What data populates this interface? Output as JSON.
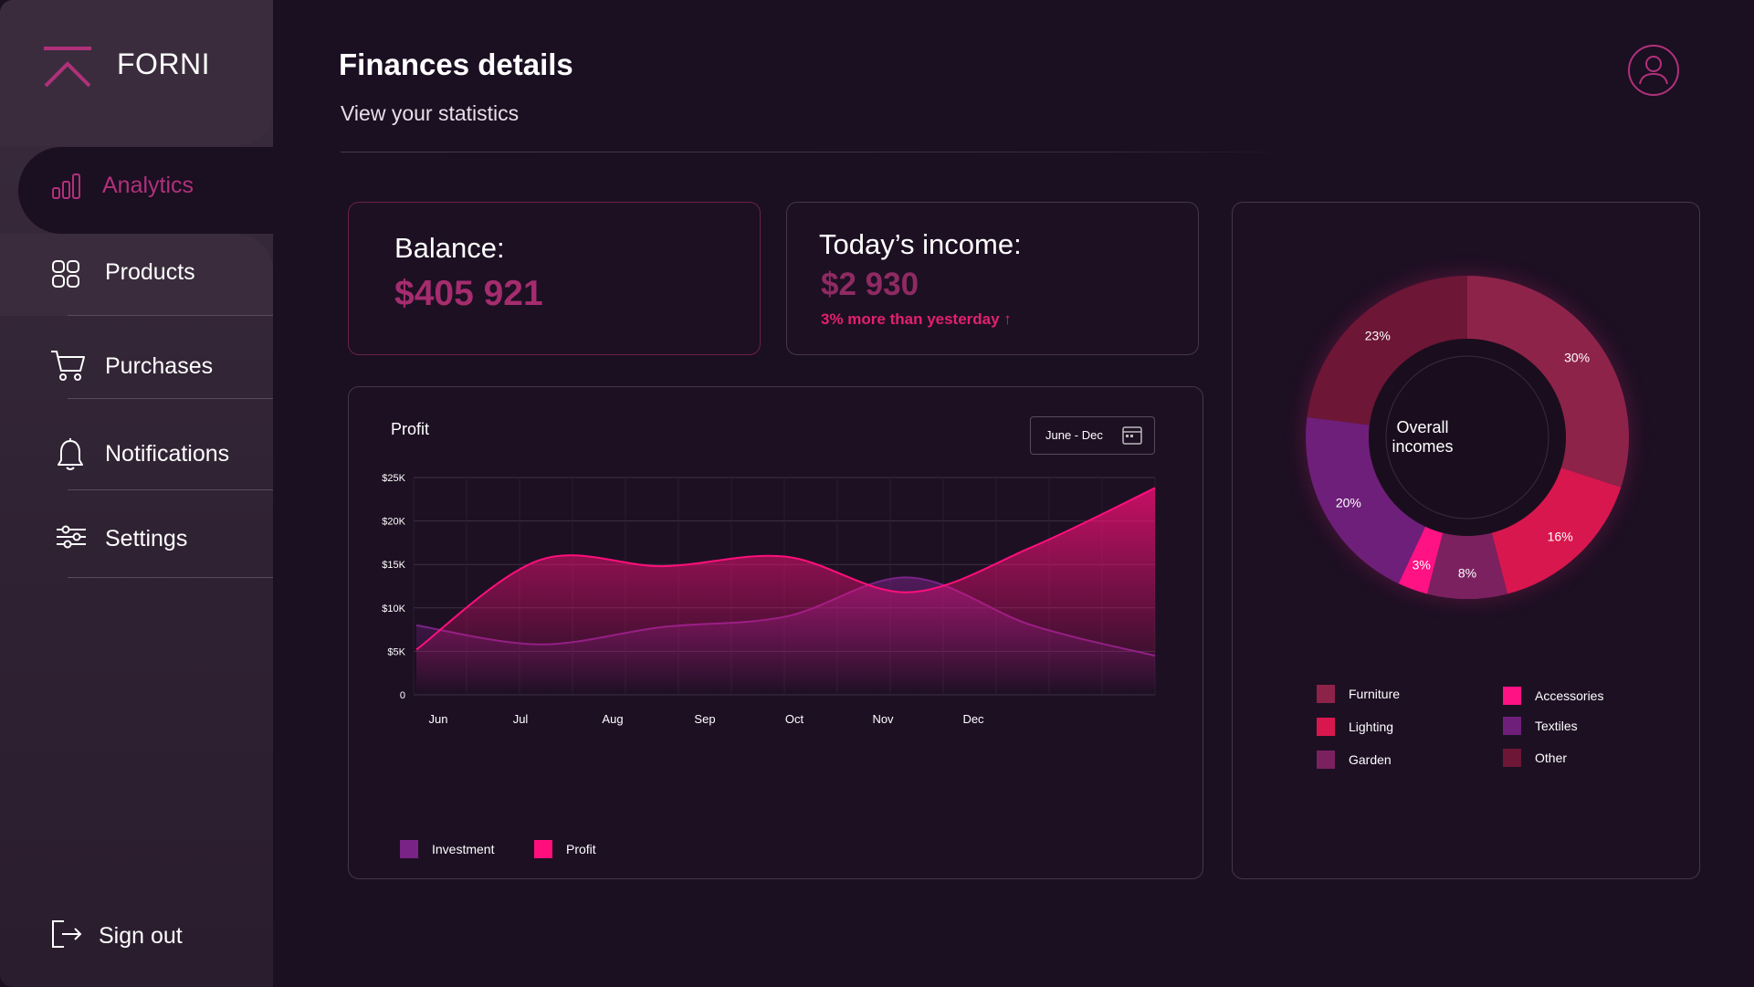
{
  "brand": {
    "name": "FORNI",
    "accent": "#b0317a"
  },
  "sidebar": {
    "items": [
      {
        "label": "Analytics",
        "icon": "bar-chart-icon",
        "active": true
      },
      {
        "label": "Products",
        "icon": "grid-icon"
      },
      {
        "label": "Purchases",
        "icon": "cart-icon"
      },
      {
        "label": "Notifications",
        "icon": "bell-icon"
      },
      {
        "label": "Settings",
        "icon": "sliders-icon"
      }
    ],
    "signout": {
      "label": "Sign out",
      "icon": "sign-out-icon"
    }
  },
  "header": {
    "title": "Finances details",
    "subtitle": "View your statistics",
    "avatar_icon": "user-icon"
  },
  "balance": {
    "label": "Balance:",
    "value": "$405 921"
  },
  "income": {
    "label": "Today’s income:",
    "value": "$2 930",
    "note": "3% more than yesterday ↑"
  },
  "profit_panel": {
    "title": "Profit",
    "date_range": "June - Dec",
    "date_icon": "calendar-icon"
  },
  "chart_data": [
    {
      "type": "area",
      "title": "Profit",
      "x": [
        "Jun",
        "Jul",
        "Aug",
        "Sep",
        "Oct",
        "Nov",
        "Dec"
      ],
      "y_ticks": [
        "0",
        "$5K",
        "$10K",
        "$15K",
        "$20K",
        "$25K"
      ],
      "ylim": [
        0,
        25000
      ],
      "grid": true,
      "legend_position": "bottom-left",
      "series": [
        {
          "name": "Investment",
          "color": "#7a2387",
          "values": [
            8000,
            5800,
            7800,
            9000,
            13500,
            8000,
            4500
          ]
        },
        {
          "name": "Profit",
          "color": "#ff0f7b",
          "values": [
            5200,
            15500,
            14800,
            15900,
            11800,
            17000,
            23800
          ]
        }
      ]
    },
    {
      "type": "pie",
      "title": "Overall incomes",
      "categories": [
        "Furniture",
        "Accessories",
        "Lighting",
        "Textiles",
        "Garden",
        "Other"
      ],
      "values": [
        30,
        3,
        16,
        20,
        8,
        23
      ],
      "labels": [
        "30%",
        "3%",
        "16%",
        "20%",
        "8%",
        "23%"
      ],
      "colors": [
        "#8e2349",
        "#ff1283",
        "#d9174f",
        "#6e1f7a",
        "#7b2160",
        "#6d1636"
      ]
    }
  ],
  "donut_legend": [
    {
      "label": "Furniture",
      "color": "#8e2349"
    },
    {
      "label": "Accessories",
      "color": "#ff1283"
    },
    {
      "label": "Lighting",
      "color": "#d9174f"
    },
    {
      "label": "Textiles",
      "color": "#6e1f7a"
    },
    {
      "label": "Garden",
      "color": "#7b2160"
    },
    {
      "label": "Other",
      "color": "#6d1636"
    }
  ]
}
